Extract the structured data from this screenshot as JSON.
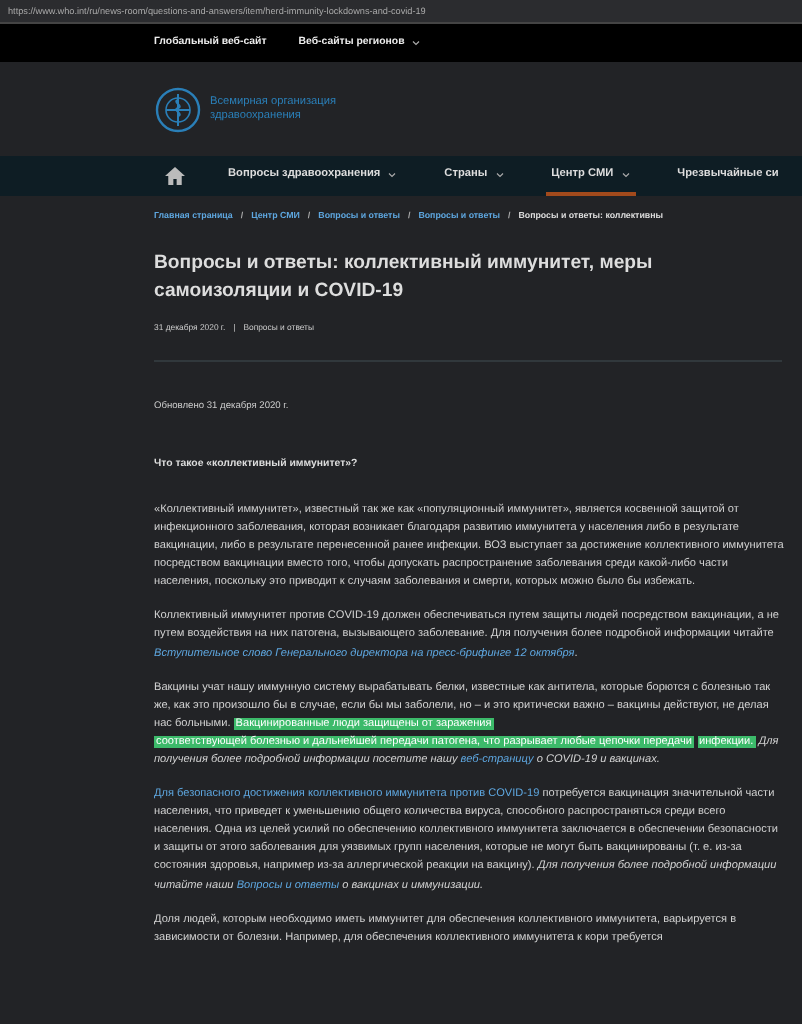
{
  "address_bar": {
    "url": "https://www.who.int/ru/news-room/questions-and-answers/item/herd-immunity-lockdowns-and-covid-19"
  },
  "top_bar": {
    "items": [
      {
        "label": "Глобальный веб-сайт",
        "dropdown": false
      },
      {
        "label": "Веб-сайты регионов",
        "dropdown": true
      }
    ]
  },
  "logo": {
    "line_1": "Всемирная организация",
    "line_2": "здравоохранения"
  },
  "nav": {
    "items": [
      {
        "label": "Вопросы здравоохранения",
        "dropdown": true,
        "selected": false
      },
      {
        "label": "Страны",
        "dropdown": true,
        "selected": false
      },
      {
        "label": "Центр СМИ",
        "dropdown": true,
        "selected": true
      },
      {
        "label": "Чрезвычайные си",
        "dropdown": false,
        "selected": false
      }
    ]
  },
  "breadcrumb_separator": "/",
  "breadcrumb": [
    {
      "label": "Главная страница",
      "current": false
    },
    {
      "label": "Центр СМИ",
      "current": false
    },
    {
      "label": "Вопросы и ответы",
      "current": false
    },
    {
      "label": "Вопросы и ответы",
      "current": false
    },
    {
      "label": "Вопросы и ответы: коллективны",
      "current": true
    }
  ],
  "article": {
    "title": "Вопросы и ответы: коллективный иммунитет, меры самоизоляции и COVID-19",
    "date": "31 декабря 2020 г.",
    "meta_separator": "|",
    "category": "Вопросы и ответы",
    "updated": "Обновлено 31 декабря 2020 г.",
    "question": "Что такое «коллективный иммунитет»?",
    "paragraphs": [
      [
        {
          "kind": "plain",
          "italic": false,
          "text": "«Коллективный иммунитет», известный так же как «популяционный иммунитет», является косвенной защитой от инфекционного заболевания, которая возникает благодаря развитию иммунитета у населения либо в результате вакцинации, либо в результате перенесенной ранее инфекции. ВОЗ выступает за достижение коллективного иммунитета посредством вакцинации вместо того, чтобы допускать распространение заболевания среди какой-либо части населения, поскольку это приводит к случаям заболевания и смерти, которых можно было бы избежать."
        }
      ],
      [
        {
          "kind": "plain",
          "italic": false,
          "text": "Коллективный иммунитет против COVID-19 должен обеспечиваться путем защиты людей посредством вакцинации, а не путем воздействия на них патогена, вызывающего заболевание. Для получения более подробной информации читайте "
        },
        {
          "kind": "link",
          "italic": true,
          "text": "Вступительное слово Генерального директора на пресс-брифинге 12"
        },
        {
          "kind": "link",
          "italic": true,
          "text": "октября"
        },
        {
          "kind": "plain",
          "italic": false,
          "text": "."
        }
      ],
      [
        {
          "kind": "plain",
          "italic": false,
          "text": "Вакцины учат нашу иммунную систему вырабатывать белки, известные как антитела, которые борются с болезнью так же, как это произошло бы в случае, если бы мы заболели, но – и это критически важно – вакцины действуют, не делая нас больными. "
        },
        {
          "kind": "highlight",
          "italic": false,
          "text": "Вакцинированные люди защищены от заражения"
        },
        {
          "kind": "highlight",
          "italic": false,
          "text": "соответствующей болезнью и дальнейшей передачи патогена, что разрывает любые цепочки передачи"
        },
        {
          "kind": "highlight",
          "italic": false,
          "text": "инфекции."
        },
        {
          "kind": "plain",
          "italic": true,
          "text": " Для получения более подробной информации посетите нашу "
        },
        {
          "kind": "link",
          "italic": true,
          "text": "веб-страницу"
        },
        {
          "kind": "plain",
          "italic": true,
          "text": " о COVID-19 и вакцинах."
        }
      ],
      [
        {
          "kind": "link",
          "italic": false,
          "text": "Для безопасного достижения коллективного иммунитета против COVID-19"
        },
        {
          "kind": "plain",
          "italic": false,
          "text": " потребуется вакцинация значительной части населения, что приведет к уменьшению общего количества вируса, способного распространяться среди всего населения. Одна из целей усилий по обеспечению коллективного иммунитета заключается в обеспечении безопасности и защиты от этого заболевания для уязвимых групп населения, которые не могут быть вакцинированы (т. е. из-за состояния здоровья, например из-за аллергической реакции на вакцину). "
        },
        {
          "kind": "plain",
          "italic": true,
          "text": "Для получения более подробной информации читайте наши "
        },
        {
          "kind": "link",
          "italic": true,
          "text": "Вопросы и ответы"
        },
        {
          "kind": "plain",
          "italic": true,
          "text": " о вакцинах и иммунизации."
        }
      ],
      [
        {
          "kind": "plain",
          "italic": false,
          "text": "Доля людей, которым необходимо иметь иммунитет для обеспечения коллективного иммунитета, варьируется в зависимости от болезни. Например, для обеспечения коллективного иммунитета к кори требуется"
        }
      ]
    ]
  }
}
